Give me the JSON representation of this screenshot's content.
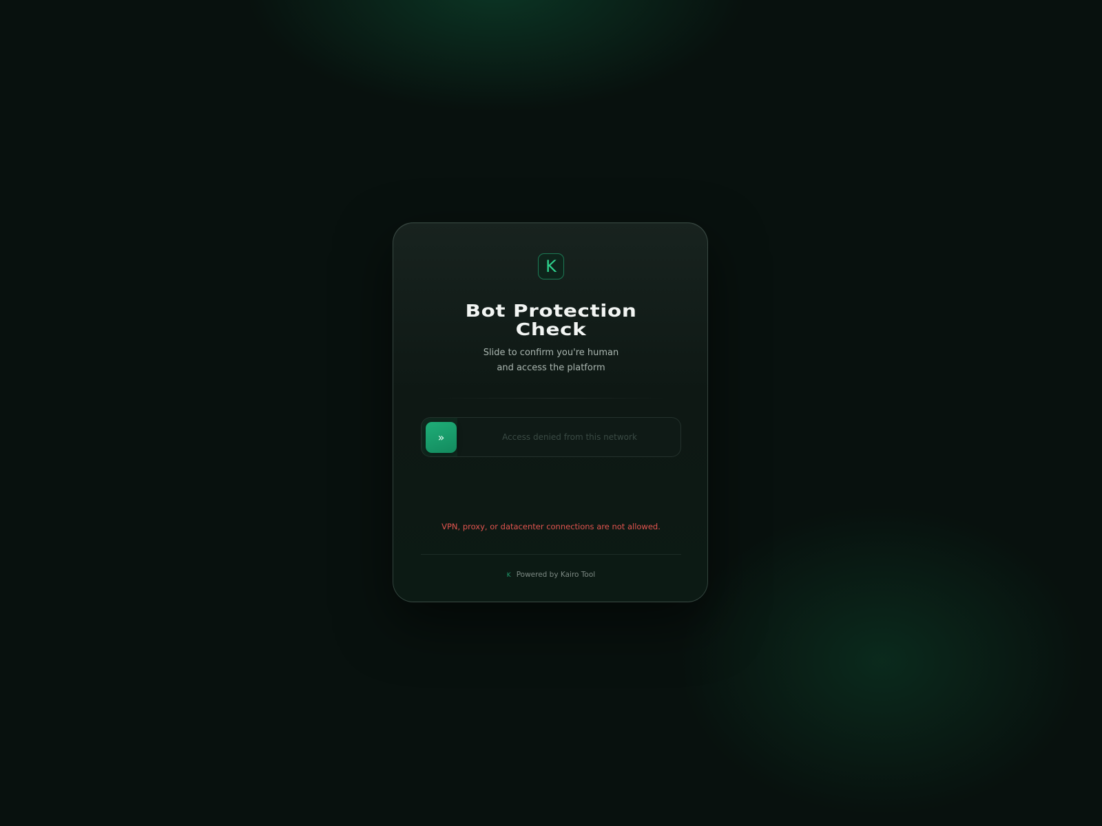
{
  "logo": {
    "letter": "K",
    "accent_color": "#2fd38e"
  },
  "title": {
    "line1": "Bot Protection",
    "line2": "Check"
  },
  "subtitle": {
    "line1": "Slide to confirm you're human",
    "line2": "and access the platform"
  },
  "slider": {
    "handle_icon": "chevrons-right-icon",
    "handle_glyph": "»",
    "status_text": "Access denied from this network",
    "progress": 0
  },
  "error": {
    "message": "VPN, proxy, or datacenter connections are not allowed.",
    "color": "#e2544f"
  },
  "footer": {
    "icon_glyph": "K",
    "text": "Powered by Kairo Tool"
  }
}
